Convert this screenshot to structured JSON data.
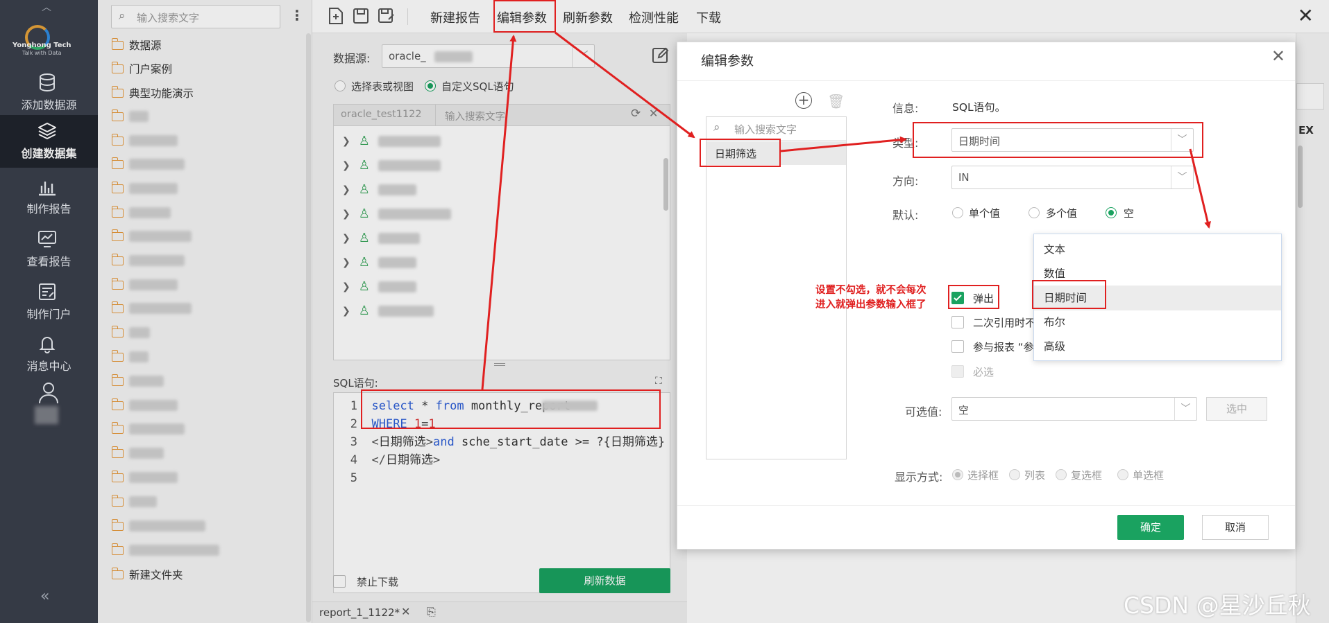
{
  "nav": {
    "logo_text": "Yonghong Tech",
    "logo_sub": "Talk with Data",
    "items": [
      {
        "label": "添加数据源",
        "icon": "database-icon"
      },
      {
        "label": "创建数据集",
        "icon": "layers-icon"
      },
      {
        "label": "制作报告",
        "icon": "bar-chart-icon"
      },
      {
        "label": "查看报告",
        "icon": "monitor-chart-icon"
      },
      {
        "label": "制作门户",
        "icon": "portal-edit-icon"
      },
      {
        "label": "消息中心",
        "icon": "bell-icon"
      }
    ]
  },
  "tree": {
    "search_placeholder": "输入搜索文字",
    "folders": [
      "数据源",
      "门户案例",
      "典型功能演示"
    ],
    "last_folder": "新建文件夹"
  },
  "toolbar": {
    "new_report": "新建报告",
    "edit_params": "编辑参数",
    "refresh_params": "刷新参数",
    "check_perf": "检测性能",
    "download": "下载"
  },
  "dataset": {
    "source_label": "数据源:",
    "source_value": "oracle_",
    "opt_table": "选择表或视图",
    "opt_sql": "自定义SQL语句",
    "tab_conn": "oracle_test1122",
    "tab_search": "输入搜索文字",
    "sql_label": "SQL语句:",
    "sql_lines": [
      {
        "n": "1",
        "parts": [
          [
            "kw",
            "select"
          ],
          [
            "t",
            " * "
          ],
          [
            "kw",
            "from"
          ],
          [
            "t",
            " monthly_report"
          ]
        ]
      },
      {
        "n": "2",
        "parts": [
          [
            "kw",
            "WHERE"
          ],
          [
            "t",
            " "
          ],
          [
            "num",
            "1"
          ],
          [
            "t",
            "="
          ],
          [
            "num",
            "1"
          ]
        ]
      },
      {
        "n": "3",
        "parts": [
          [
            "tagc",
            "<"
          ],
          [
            "t",
            "日期筛选"
          ],
          [
            "tagc",
            ">"
          ],
          [
            "kw",
            "and"
          ],
          [
            "t",
            " sche_start_date >= ?{日期筛选}"
          ]
        ]
      },
      {
        "n": "4",
        "parts": [
          [
            "tagc",
            "</"
          ],
          [
            "t",
            "日期筛选"
          ],
          [
            "tagc",
            ">"
          ]
        ]
      },
      {
        "n": "5",
        "parts": []
      }
    ],
    "no_download": "禁止下载",
    "refresh_data": "刷新数据",
    "bottom_tab": "report_1_1122*"
  },
  "dialog": {
    "title": "编辑参数",
    "param_search_placeholder": "输入搜索文字",
    "param_item": "日期筛选",
    "info_label": "信息:",
    "info_value": "SQL语句。",
    "type_label": "类型:",
    "type_value": "日期时间",
    "direction_label": "方向:",
    "direction_value": "IN",
    "default_label": "默认:",
    "default_opts": [
      "单个值",
      "多个值",
      "空"
    ],
    "popup_label": "弹出",
    "second_ref_label": "二次引用时不",
    "join_report_label": "参与报表 “参",
    "required_label": "必选",
    "selectable_label": "可选值:",
    "selectable_value": "空",
    "select_btn": "选中",
    "display_label": "显示方式:",
    "display_opts": [
      "选择框",
      "列表",
      "复选框",
      "单选框"
    ],
    "ok": "确定",
    "cancel": "取消",
    "type_options": [
      "文本",
      "数值",
      "日期时间",
      "布尔",
      "高级"
    ]
  },
  "annotation": {
    "line1": "设置不勾选，就不会每次",
    "line2": "进入就弹出参数输入框了"
  },
  "watermark": "CSDN @星沙丘秋",
  "colors": {
    "accent_green": "#1aa260",
    "annotation_red": "#e02020",
    "nav_bg": "#3a3f4b"
  }
}
